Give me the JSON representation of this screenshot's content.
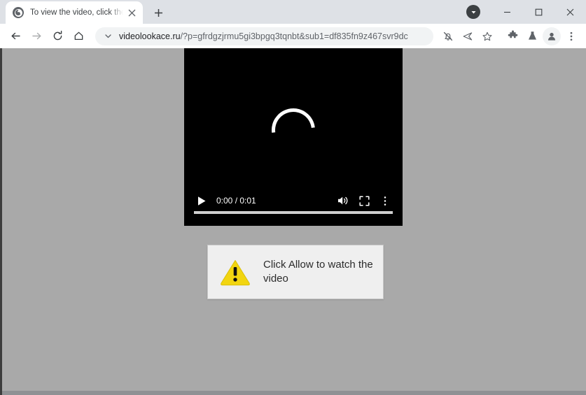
{
  "browser": {
    "tab": {
      "title": "To view the video, click the Allow",
      "favicon": "globe-icon",
      "close_label": "×"
    },
    "new_tab_label": "+",
    "window_controls": {
      "download_icon": "download-chevron-icon",
      "minimize": "—",
      "maximize": "☐",
      "close": "✕"
    },
    "nav": {
      "back": "back-arrow-icon",
      "forward": "forward-arrow-icon",
      "reload": "reload-icon",
      "home": "home-icon"
    },
    "omnibox": {
      "chevron": "chevron-down-icon",
      "host": "videolookace.ru",
      "path": "/?p=gfrdgzjrmu5gi3bpgq3tqnbt&sub1=df835fn9z467svr9dc",
      "full_url": "videolookace.ru/?p=gfrdgzjrmu5gi3bpgq3tqnbt&sub1=df835fn9z467svr9dc"
    },
    "toolbar_icons": [
      {
        "name": "notifications-blocked-icon"
      },
      {
        "name": "share-icon"
      },
      {
        "name": "bookmark-star-icon"
      },
      {
        "name": "extensions-puzzle-icon"
      },
      {
        "name": "experiments-flask-icon"
      },
      {
        "name": "profile-avatar-icon"
      },
      {
        "name": "chrome-menu-icon"
      }
    ]
  },
  "page": {
    "background_color": "#a9a9a9",
    "video": {
      "state": "loading",
      "spinner": "loading-spinner",
      "controls": {
        "play": "play-icon",
        "time": "0:00 / 0:01",
        "current_time": "0:00",
        "duration": "0:01",
        "volume": "volume-icon",
        "fullscreen": "fullscreen-icon",
        "more": "more-options-icon"
      }
    },
    "alert": {
      "icon": "warning-triangle-icon",
      "icon_color": "#f2d510",
      "message": "Click Allow to watch the video"
    }
  }
}
